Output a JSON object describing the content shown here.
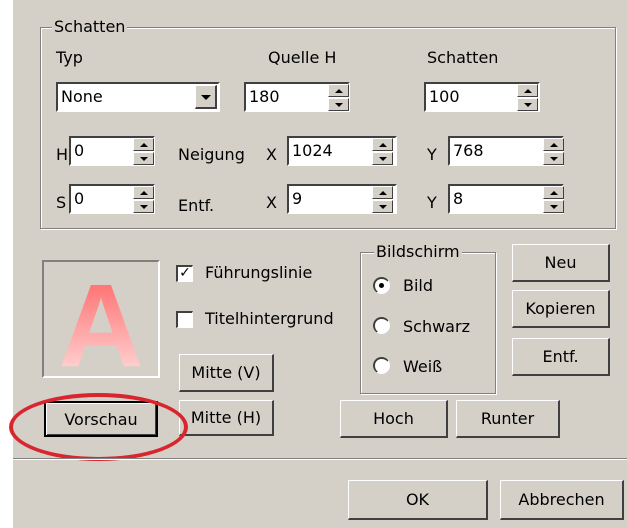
{
  "shadow_group": {
    "legend": "Schatten",
    "typ_label": "Typ",
    "typ_value": "None",
    "quelle_label": "Quelle H",
    "quelle_value": "180",
    "schatten_label": "Schatten",
    "schatten_value": "100",
    "h_label": "H",
    "h_value": "0",
    "neigung_label": "Neigung",
    "neigung_x_label": "X",
    "neigung_x_value": "1024",
    "neigung_y_label": "Y",
    "neigung_y_value": "768",
    "s_label": "S",
    "s_value": "0",
    "entf_label": "Entf.",
    "entf_x_label": "X",
    "entf_x_value": "9",
    "entf_y_label": "Y",
    "entf_y_value": "8"
  },
  "preview": {
    "letter": "A"
  },
  "options": {
    "fuehrungslinie": "Führungslinie",
    "fuehrungslinie_checked": true,
    "titelhintergrund": "Titelhintergrund",
    "titelhintergrund_checked": false
  },
  "bildschirm": {
    "legend": "Bildschirm",
    "options": [
      "Bild",
      "Schwarz",
      "Weiß"
    ],
    "selected": "Bild"
  },
  "buttons": {
    "neu": "Neu",
    "kopieren": "Kopieren",
    "entf": "Entf.",
    "mitte_v": "Mitte (V)",
    "mitte_h": "Mitte (H)",
    "vorschau": "Vorschau",
    "hoch": "Hoch",
    "runter": "Runter",
    "ok": "OK",
    "abbrechen": "Abbrechen"
  },
  "colors": {
    "dialog_bg": "#d4d0c8",
    "highlight": "#d9262e",
    "preview_letter_top": "#ff6b6b",
    "preview_letter_bottom": "#ffe6e6"
  }
}
